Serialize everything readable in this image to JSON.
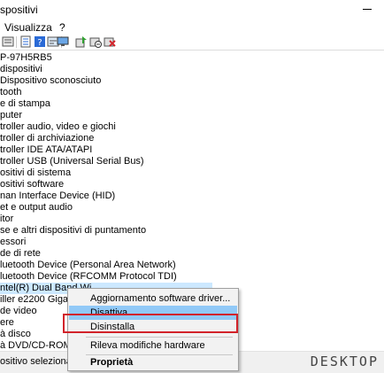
{
  "window": {
    "title": "spositivi"
  },
  "menu": {
    "items": [
      "Visualizza",
      "?"
    ]
  },
  "toolbar": {
    "icons": [
      "tree-view-icon",
      "properties-icon",
      "help-icon",
      "device-view-icon",
      "monitor-icon",
      "update-driver-icon",
      "disable-device-icon",
      "uninstall-device-icon"
    ]
  },
  "tree": {
    "rows": [
      "P-97H5RB5",
      "dispositivi",
      "Dispositivo sconosciuto",
      "tooth",
      "e di stampa",
      "puter",
      "troller audio, video e giochi",
      "troller di archiviazione",
      "troller IDE ATA/ATAPI",
      "troller USB (Universal Serial Bus)",
      "ositivi di sistema",
      "ositivi software",
      "nan Interface Device (HID)",
      "et e output audio",
      "itor",
      "se e altri dispositivi di puntamento",
      "essori",
      "de di rete",
      "luetooth Device (Personal Area Network)",
      "luetooth Device (RFCOMM Protocol TDI)",
      "ntel(R) Dual Band Wi",
      "iller e2200 Gigabit Et",
      "de video",
      "ere",
      "à disco",
      "à DVD/CD-ROM"
    ],
    "selected_index": 20
  },
  "context_menu": {
    "items": [
      "Aggiornamento software driver...",
      "Disattiva",
      "Disinstalla",
      "Rileva modifiche hardware",
      "Proprietà"
    ],
    "highlighted_index": 1
  },
  "status": {
    "text": "ositivo selezionato."
  },
  "watermark": {
    "text": "DESKTOP"
  },
  "colors": {
    "selection": "#cce8ff",
    "menu_highlight": "#91c9f7",
    "annotation": "#d2232a"
  }
}
